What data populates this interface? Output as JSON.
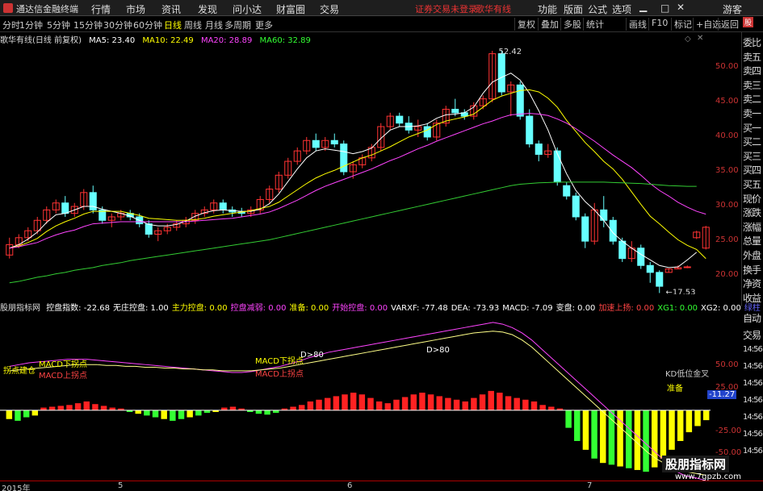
{
  "app": {
    "title": "通达信金融终端",
    "menus": [
      "行情",
      "市场",
      "资讯",
      "发现",
      "问小达",
      "财富圈",
      "交易"
    ],
    "status": "证券交易未登录",
    "stock_name": "歌华有线",
    "right_menus": [
      "功能",
      "版面",
      "公式",
      "选项"
    ],
    "guest": "游客"
  },
  "toolbar": {
    "periods": [
      "分时",
      "1分钟",
      "5分钟",
      "15分钟",
      "30分钟",
      "60分钟",
      "日线",
      "周线",
      "月线",
      "多周期",
      "更多"
    ],
    "active": "日线",
    "buttons": [
      "复权",
      "叠加",
      "多股",
      "统计",
      "画线",
      "F10",
      "标记",
      "+自选",
      "返回"
    ]
  },
  "legend": {
    "title": "歌华有线(日线 前复权)",
    "ma": [
      {
        "label": "MA5: 23.40",
        "color": "#ffffff"
      },
      {
        "label": "MA10: 22.49",
        "color": "#ffff00"
      },
      {
        "label": "MA20: 28.89",
        "color": "#ff44ff"
      },
      {
        "label": "MA60: 32.89",
        "color": "#33ff33"
      }
    ]
  },
  "price_axis": [
    "50.00",
    "45.00",
    "40.00",
    "35.00",
    "30.00",
    "25.00",
    "20.00"
  ],
  "price_annotations": {
    "high": "52.42",
    "low": "17.53"
  },
  "side_panel": [
    "委比",
    "卖五",
    "卖四",
    "卖三",
    "卖二",
    "卖一",
    "买一",
    "买二",
    "买三",
    "买四",
    "买五",
    "现价",
    "涨跌",
    "涨幅",
    "总量",
    "外盘",
    "换手",
    "净资",
    "收益"
  ],
  "indicator": {
    "name": "股朋指标网",
    "items": [
      {
        "label": "控盘指数:",
        "value": "-22.68",
        "color": "#ffffff"
      },
      {
        "label": "无庄控盘:",
        "value": "1.00",
        "color": "#ffffff"
      },
      {
        "label": "主力控盘:",
        "value": "0.00",
        "color": "#ffff00"
      },
      {
        "label": "控盘减弱:",
        "value": "0.00",
        "color": "#ff44ff"
      },
      {
        "label": "准备:",
        "value": "0.00",
        "color": "#ffff00"
      },
      {
        "label": "开始控盘:",
        "value": "0.00",
        "color": "#ff44ff"
      },
      {
        "label": "VARXF:",
        "value": "-77.48",
        "color": "#ffffff"
      },
      {
        "label": "DEA:",
        "value": "-73.93",
        "color": "#ffffff"
      },
      {
        "label": "MACD:",
        "value": "-7.09",
        "color": "#ffffff"
      },
      {
        "label": "变盘:",
        "value": "0.00",
        "color": "#ffffff"
      },
      {
        "label": "加速上扬:",
        "value": "0.00",
        "color": "#ff4444"
      },
      {
        "label": "XG1:",
        "value": "0.00",
        "color": "#33ff33"
      },
      {
        "label": "XG2:",
        "value": "0.00",
        "color": "#ffffff"
      }
    ],
    "tail": "绿柱"
  },
  "ind_axis": [
    "50.00",
    "25.00",
    "-25.00",
    "-50.00"
  ],
  "ind_annotations": {
    "buy": "拐点建仓",
    "macd_up": "MACD上拐点",
    "macd_down": "MACD下拐点",
    "d80": "D>80",
    "kd": "KD低位金叉",
    "ready": "准备",
    "current": "-11.27"
  },
  "ind_side": [
    "自动",
    "交易",
    "14:56",
    "14:56",
    "14:56",
    "14:56",
    "14:56",
    "14:56",
    "14:56"
  ],
  "dates": [
    "2015年",
    "5",
    "6",
    "7"
  ],
  "watermark": {
    "name": "股朋指标网",
    "url": "www.7gpzb.com"
  },
  "chart_data": {
    "type": "candlestick",
    "title": "歌华有线(日线 前复权)",
    "ylim": [
      17,
      53
    ],
    "candles": [
      [
        23,
        25.5,
        22.5,
        24.5
      ],
      [
        24.5,
        26,
        24,
        25.5
      ],
      [
        25.5,
        27,
        25,
        26.5
      ],
      [
        26.5,
        28.5,
        26,
        28
      ],
      [
        28,
        30,
        27.5,
        29.5
      ],
      [
        29.5,
        31,
        29,
        30.5
      ],
      [
        30.5,
        31.5,
        28.5,
        29
      ],
      [
        29,
        30.5,
        28.5,
        30
      ],
      [
        30,
        32.5,
        29.5,
        32
      ],
      [
        32,
        33,
        29,
        29.5
      ],
      [
        29.5,
        30,
        27.5,
        28
      ],
      [
        28,
        29,
        27,
        28.5
      ],
      [
        28.5,
        29.5,
        28,
        29
      ],
      [
        29,
        29.5,
        28,
        28.5
      ],
      [
        28.5,
        29,
        27,
        27.5
      ],
      [
        27.5,
        28,
        25.5,
        26
      ],
      [
        26,
        27,
        25,
        26.5
      ],
      [
        26.5,
        27.5,
        26,
        27
      ],
      [
        27,
        28,
        26.5,
        27.5
      ],
      [
        27.5,
        28.5,
        27,
        28
      ],
      [
        28,
        29.5,
        27.5,
        29
      ],
      [
        29,
        30,
        28.5,
        29.5
      ],
      [
        29.5,
        31,
        29,
        30.5
      ],
      [
        30.5,
        31,
        29,
        29.5
      ],
      [
        29.5,
        30,
        28.5,
        29.2
      ],
      [
        29.2,
        29.8,
        28.5,
        29
      ],
      [
        29,
        30,
        28.5,
        29.5
      ],
      [
        29.5,
        31.5,
        29,
        31
      ],
      [
        31,
        33,
        30.5,
        32.5
      ],
      [
        32.5,
        35,
        32,
        34.5
      ],
      [
        34.5,
        37,
        34,
        36.5
      ],
      [
        36.5,
        38.5,
        36,
        38
      ],
      [
        38,
        40,
        37.5,
        39.5
      ],
      [
        39.5,
        40.5,
        38,
        38.5
      ],
      [
        38.5,
        40,
        38,
        39.5
      ],
      [
        39.5,
        40.5,
        38.5,
        39
      ],
      [
        39,
        39.5,
        34.5,
        35
      ],
      [
        35,
        36.5,
        34,
        36
      ],
      [
        36,
        37.5,
        35.5,
        37
      ],
      [
        37,
        39,
        36.5,
        38.5
      ],
      [
        38.5,
        42,
        38,
        41.5
      ],
      [
        41.5,
        43.5,
        41,
        43
      ],
      [
        43,
        43.5,
        41.5,
        42
      ],
      [
        42,
        43,
        40.5,
        41
      ],
      [
        41,
        42.5,
        40,
        41.5
      ],
      [
        41.5,
        42,
        39.5,
        40
      ],
      [
        40,
        42.5,
        39.5,
        42
      ],
      [
        42,
        44.5,
        41.5,
        44
      ],
      [
        44,
        45.5,
        43,
        43.5
      ],
      [
        43.5,
        44,
        42.5,
        43
      ],
      [
        43,
        45,
        42.5,
        44.5
      ],
      [
        44.5,
        46,
        44,
        45.5
      ],
      [
        45.5,
        52.42,
        45,
        52
      ],
      [
        52,
        52.5,
        46,
        46.5
      ],
      [
        46.5,
        48,
        43,
        47.5
      ],
      [
        47.5,
        48,
        42.5,
        43
      ],
      [
        43,
        44,
        38.5,
        39
      ],
      [
        39,
        39.5,
        36.5,
        37.5
      ],
      [
        37.5,
        39,
        37,
        38
      ],
      [
        38,
        38.5,
        33,
        33.5
      ],
      [
        33,
        33.5,
        31,
        31.5
      ],
      [
        31.5,
        32,
        28,
        28.5
      ],
      [
        28.5,
        29,
        24,
        25
      ],
      [
        25,
        30.5,
        24.5,
        29.5
      ],
      [
        29.5,
        31.5,
        27,
        28
      ],
      [
        28,
        28.5,
        24.5,
        25
      ],
      [
        25,
        25.5,
        22,
        22.5
      ],
      [
        22.5,
        25,
        22,
        24
      ],
      [
        24,
        24.5,
        21,
        21.5
      ],
      [
        21.5,
        22,
        19,
        20.5
      ],
      [
        20.5,
        20.8,
        17.53,
        18.5
      ],
      [
        20.5,
        21,
        20.5,
        21
      ],
      [
        21,
        21.5,
        21,
        21.2
      ],
      [
        21.2,
        21.5,
        21.1,
        21.3
      ],
      [
        25.5,
        26.5,
        25.3,
        26.3
      ],
      [
        24,
        27.2,
        23.8,
        27
      ]
    ],
    "series": [
      {
        "name": "MA5",
        "values": [
          24,
          24.5,
          25.3,
          26.3,
          27.7,
          28.8,
          29,
          29.5,
          30,
          30,
          29.6,
          29.3,
          29,
          28.6,
          28,
          27.4,
          27.2,
          27.2,
          27.4,
          27.9,
          28.6,
          29.1,
          29.4,
          29.5,
          29.4,
          29.3,
          29.3,
          29.6,
          30.4,
          31.8,
          33.6,
          35.4,
          37,
          38,
          38.3,
          38.1,
          37.9,
          37.6,
          37.9,
          38.4,
          39.8,
          41,
          41.5,
          41.5,
          41.6,
          41.9,
          42.7,
          43.2,
          43.3,
          43.5,
          44.3,
          46.3,
          47.9,
          48.6,
          49.2,
          48.2,
          46.3,
          43.8,
          41,
          37.6,
          34.7,
          32.3,
          30.7,
          29.5,
          28,
          26.2,
          25,
          24,
          23.1,
          22.3,
          21.5,
          21.2,
          21.3,
          22.3,
          23.4
        ]
      },
      {
        "name": "MA10",
        "values": [
          24,
          24.3,
          24.8,
          25.4,
          26.4,
          27.2,
          27.8,
          28.3,
          28.9,
          29.3,
          29.3,
          29.3,
          29.3,
          29,
          28.7,
          28.3,
          28.2,
          28.1,
          28,
          28,
          28.1,
          28.3,
          28.6,
          28.8,
          29,
          29.2,
          29.4,
          29.7,
          30,
          30.6,
          31.5,
          32.4,
          33.3,
          34.1,
          34.7,
          35.2,
          35.8,
          36.4,
          37,
          37.4,
          38,
          38.6,
          39.3,
          40,
          40.5,
          41,
          41.8,
          42.3,
          42.6,
          42.9,
          43.3,
          44.3,
          45.3,
          45.9,
          46.3,
          46.7,
          46.8,
          46.5,
          45.6,
          44.3,
          42.4,
          40.8,
          39.2,
          37.9,
          36.5,
          35.4,
          33.9,
          32.1,
          30.3,
          28.6,
          27.5,
          26.3,
          25.2,
          24.4,
          23.8,
          22.49
        ]
      },
      {
        "name": "MA20",
        "values": [
          24,
          24.2,
          24.5,
          24.8,
          25.4,
          25.9,
          26.3,
          26.6,
          27.1,
          27.5,
          27.6,
          27.7,
          27.8,
          27.8,
          27.8,
          27.8,
          27.8,
          27.8,
          27.8,
          27.8,
          27.9,
          28,
          28.1,
          28.2,
          28.3,
          28.5,
          28.7,
          28.9,
          29.2,
          29.7,
          30.3,
          30.9,
          31.6,
          32.3,
          32.9,
          33.4,
          33.9,
          34.4,
          34.9,
          35.4,
          36,
          36.6,
          37.1,
          37.7,
          38.3,
          38.8,
          39.4,
          39.9,
          40.4,
          40.9,
          41.4,
          41.9,
          42.3,
          42.8,
          43.2,
          43.3,
          43.4,
          43.3,
          43.1,
          42.6,
          42,
          41.2,
          40.3,
          39.4,
          38.4,
          37.4,
          36.5,
          35.6,
          34.5,
          33.3,
          32.3,
          31.5,
          30.6,
          29.9,
          29.3,
          28.89
        ]
      },
      {
        "name": "MA60",
        "values": [
          19,
          19.2,
          19.5,
          19.8,
          20,
          20.3,
          20.5,
          20.8,
          21,
          21.2,
          21.5,
          21.7,
          21.9,
          22.2,
          22.4,
          22.6,
          22.8,
          23,
          23.2,
          23.4,
          23.6,
          23.8,
          24,
          24.2,
          24.4,
          24.6,
          24.8,
          25,
          25.2,
          25.5,
          25.8,
          26.1,
          26.4,
          26.7,
          27,
          27.3,
          27.6,
          27.9,
          28.2,
          28.5,
          28.8,
          29.1,
          29.4,
          29.7,
          30,
          30.3,
          30.6,
          30.9,
          31.2,
          31.5,
          31.8,
          32.1,
          32.4,
          32.7,
          33,
          33.2,
          33.3,
          33.4,
          33.45,
          33.5,
          33.5,
          33.5,
          33.5,
          33.5,
          33.5,
          33.45,
          33.4,
          33.35,
          33.3,
          33.2,
          33.1,
          33,
          32.95,
          32.9,
          32.89
        ]
      }
    ],
    "indicator_bars": [
      -10,
      -12,
      -8,
      -6,
      3,
      4,
      5,
      6,
      8,
      10,
      7,
      5,
      3,
      2,
      -2,
      -4,
      -6,
      -8,
      -10,
      -12,
      -10,
      -8,
      -6,
      -3,
      -2,
      3,
      4,
      2,
      -2,
      -4,
      -5,
      -3,
      2,
      4,
      6,
      10,
      12,
      14,
      16,
      18,
      20,
      18,
      14,
      10,
      8,
      12,
      15,
      18,
      20,
      18,
      16,
      14,
      12,
      10,
      14,
      18,
      22,
      20,
      16,
      14,
      12,
      10,
      6,
      4,
      2,
      -20,
      -35,
      -45,
      -55,
      -60,
      -62,
      -64,
      -66,
      -68,
      -70,
      -65,
      -55,
      -45,
      -35,
      -25,
      -18,
      -11.27
    ],
    "indicator_lines": [
      {
        "name": "线1",
        "values": [
          50,
          52,
          54,
          55,
          56,
          57,
          58,
          58,
          58,
          57,
          56,
          55,
          54,
          53,
          52,
          51,
          50,
          49,
          48,
          47,
          46,
          45,
          44,
          43,
          43,
          44,
          46,
          48,
          50,
          53,
          56,
          60,
          63,
          66,
          68,
          70,
          72,
          74,
          76,
          78,
          80,
          82,
          84,
          86,
          88,
          90,
          92,
          94,
          96,
          98,
          100,
          98,
          94,
          88,
          80,
          70,
          60,
          50,
          40,
          30,
          20,
          10,
          0,
          -10,
          -20,
          -30,
          -40,
          -50,
          -60,
          -70,
          -75,
          -77,
          -80
        ]
      },
      {
        "name": "线2",
        "values": [
          45,
          46,
          47,
          48,
          49,
          50,
          51,
          52,
          52,
          52,
          51,
          51,
          50,
          50,
          49,
          49,
          48,
          48,
          47,
          47,
          46,
          46,
          45,
          45,
          45,
          45,
          46,
          47,
          48,
          50,
          52,
          54,
          56,
          58,
          60,
          62,
          64,
          66,
          68,
          70,
          72,
          74,
          76,
          78,
          80,
          82,
          84,
          86,
          88,
          89,
          90,
          89,
          86,
          80,
          72,
          62,
          52,
          42,
          32,
          22,
          12,
          2,
          -8,
          -18,
          -28,
          -38,
          -48,
          -56,
          -62,
          -66,
          -70,
          -72,
          -73.93
        ]
      }
    ]
  }
}
